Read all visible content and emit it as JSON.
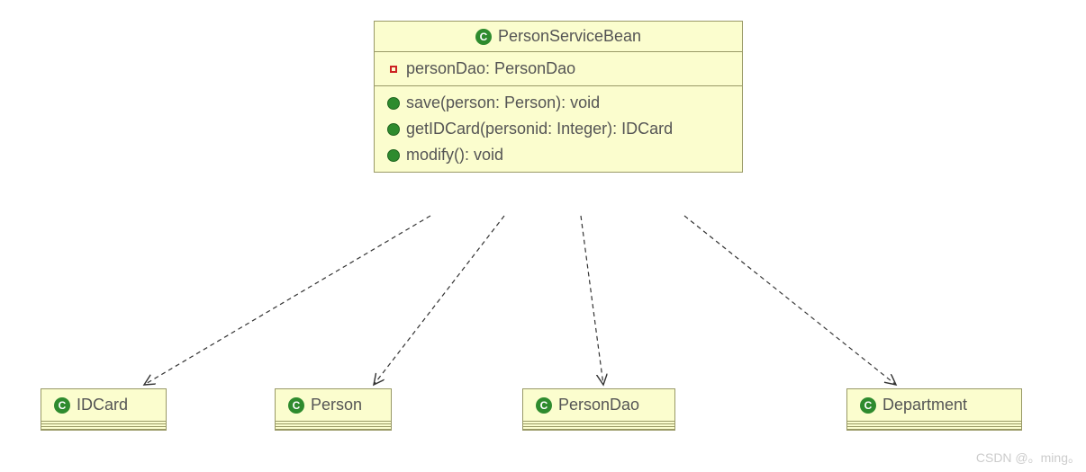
{
  "mainClass": {
    "name": "PersonServiceBean",
    "attributes": [
      {
        "vis": "private",
        "text": "personDao: PersonDao"
      }
    ],
    "operations": [
      {
        "vis": "public",
        "text": "save(person: Person): void"
      },
      {
        "vis": "public",
        "text": "getIDCard(personid: Integer): IDCard"
      },
      {
        "vis": "public",
        "text": "modify(): void"
      }
    ]
  },
  "dependencies": [
    {
      "name": "IDCard"
    },
    {
      "name": "Person"
    },
    {
      "name": "PersonDao"
    },
    {
      "name": "Department"
    }
  ],
  "watermark": "CSDN @。ming。"
}
